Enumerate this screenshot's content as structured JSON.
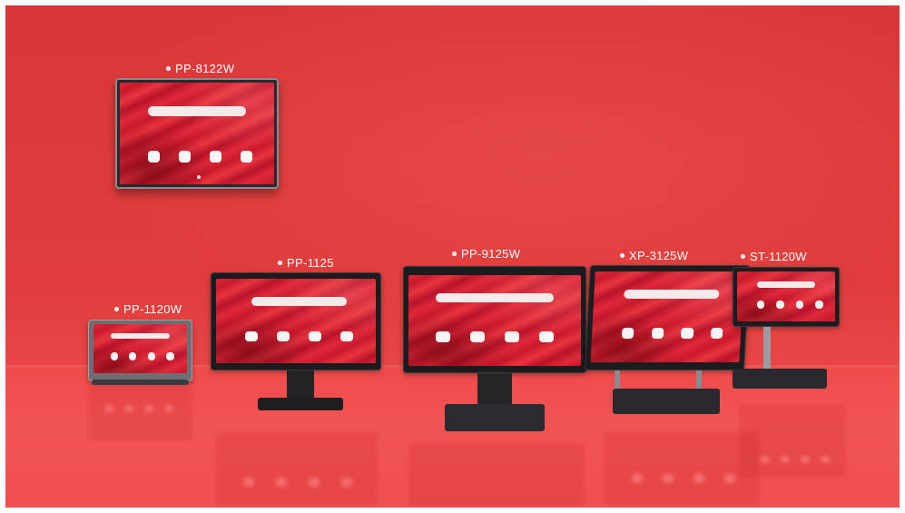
{
  "scene": {
    "background_color": "#e03c3c",
    "floor_color": "#f04a4a"
  },
  "products": [
    {
      "model": "PP-8122W"
    },
    {
      "model": "PP-1120W"
    },
    {
      "model": "PP-1125"
    },
    {
      "model": "PP-9125W"
    },
    {
      "model": "XP-3125W"
    },
    {
      "model": "ST-1120W"
    }
  ]
}
